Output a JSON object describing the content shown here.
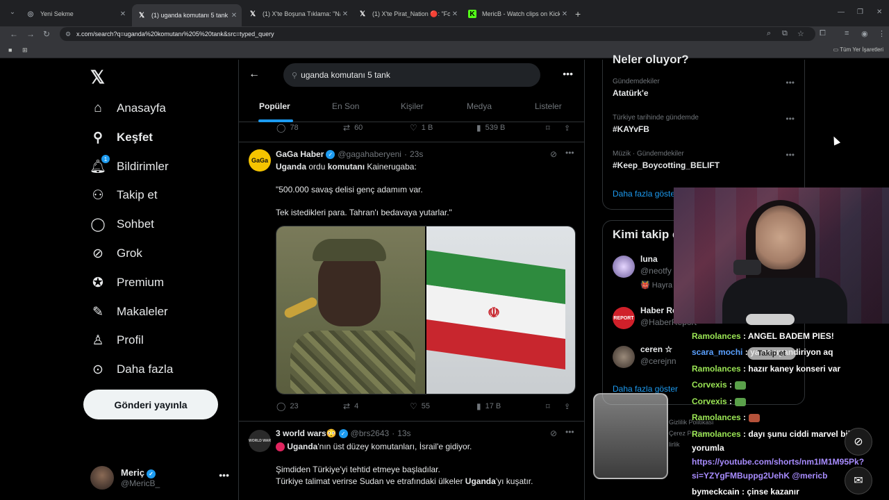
{
  "browser": {
    "tabs": [
      {
        "label": "Yeni Sekme",
        "icon": "chrome-icon"
      },
      {
        "label": "(1) uganda komutanı 5 tank - A",
        "icon": "x-icon"
      },
      {
        "label": "(1) X'te Boşuna Tıklama: \"Nakit",
        "icon": "x-icon"
      },
      {
        "label": "(1) X'te Pirat_Nation 🔴: \"Form",
        "icon": "x-icon"
      },
      {
        "label": "MericB - Watch clips on Kick",
        "icon": "kick-icon"
      }
    ],
    "url": "x.com/search?q=uganda%20komutanı%205%20tank&src=typed_query",
    "bookmarks_all": "Tüm Yer İşaretleri",
    "colors": {
      "tabbar": "#202124",
      "toolbar": "#35363a"
    }
  },
  "nav": {
    "items": [
      {
        "label": "Anasayfa",
        "icon": "home-icon"
      },
      {
        "label": "Keşfet",
        "icon": "search-icon"
      },
      {
        "label": "Bildirimler",
        "icon": "bell-icon",
        "badge": "1"
      },
      {
        "label": "Takip et",
        "icon": "person-add-icon"
      },
      {
        "label": "Sohbet",
        "icon": "chat-icon"
      },
      {
        "label": "Grok",
        "icon": "grok-icon"
      },
      {
        "label": "Premium",
        "icon": "premium-icon"
      },
      {
        "label": "Makaleler",
        "icon": "articles-icon"
      },
      {
        "label": "Profil",
        "icon": "profile-icon"
      },
      {
        "label": "Daha fazla",
        "icon": "more-circle-icon"
      }
    ],
    "post_button": "Gönderi yayınla",
    "account": {
      "name": "Meriç",
      "handle": "@MericB_"
    }
  },
  "search": {
    "query": "uganda komutanı 5 tank",
    "tabs": [
      "Popüler",
      "En Son",
      "Kişiler",
      "Medya",
      "Listeler"
    ],
    "active_tab": "Popüler"
  },
  "prev_actions": {
    "replies": "78",
    "reposts": "60",
    "likes": "1 B",
    "views": "539 B"
  },
  "tweets": [
    {
      "name": "GaGa Haber",
      "handle": "@gagahaberyeni",
      "time": "23s",
      "avatar_text": "GaGa",
      "line1_bold": "Uganda",
      "line1_a": " ordu ",
      "line1_bold2": "komutanı",
      "line1_b": " Kainerugaba:",
      "para2": "\"500.000 savaş delisi genç adamım var.",
      "para3": "Tek istedikleri para. Tahran'ı bedavaya yutarlar.\"",
      "actions": {
        "replies": "23",
        "reposts": "4",
        "likes": "55",
        "views": "17 B"
      }
    },
    {
      "name": "3 world wars😳",
      "handle": "@brs2643",
      "time": "13s",
      "avatar_text": "WORLD WAR",
      "line1_bold": "Uganda",
      "line1_b": "'nın üst düzey komutanları, İsrail'e gidiyor.",
      "para2": "Şimdiden Türkiye'yi tehtid etmeye başladılar.",
      "para3_a": "Türkiye talimat verirse Sudan ve etrafındaki ülkeler ",
      "para3_bold": "Uganda",
      "para3_b": "'yı kuşatır."
    }
  ],
  "trends": {
    "heading": "Neler oluyor?",
    "items": [
      {
        "context": "Gündemdekiler",
        "name": "Atatürk'e"
      },
      {
        "context": "Türkiye tarihinde gündemde",
        "name": "#KAYvFB"
      },
      {
        "context": "Müzik · Gündemdekiler",
        "name": "#Keep_Boycotting_BELIFT"
      }
    ],
    "more": "Daha fazla göster"
  },
  "who_to_follow": {
    "heading": "Kimi takip et",
    "items": [
      {
        "name": "luna",
        "handle": "@neotfy",
        "extra": "👹 Hayra"
      },
      {
        "name": "Haber Re",
        "handle": "@HaberReport"
      },
      {
        "name": "ceren ☆",
        "handle": "@cerejnn"
      }
    ],
    "more": "Daha fazla göster"
  },
  "footer": {
    "line1": "Gizlilik Politikası",
    "line2": "Çerez Politikası",
    "line3": "lirlik"
  },
  "overlay": {
    "follow_button": "Takip et",
    "chat": [
      {
        "user": "Ramolances",
        "msg": "ANGEL BADEM PIES!"
      },
      {
        "user": "scara_mochi",
        "msg": "ya ne uyandiriyon aq",
        "color": "blue"
      },
      {
        "user": "Ramolances",
        "msg": "hazır kaney konseri var"
      },
      {
        "user": "Corvexis",
        "msg": "",
        "emoji": "money"
      },
      {
        "user": "Corvexis",
        "msg": "",
        "emoji": "money"
      },
      {
        "user": "Ramolances",
        "msg": "",
        "emoji": "box"
      },
      {
        "user": "Ramolances",
        "msg": "dayı şunu ciddi marvel bilgiyle yorumla"
      },
      {
        "user": "",
        "link": "https://youtube.com/shorts/nm1IM1M95Pk?si=YZYgFMBuppg2UehK",
        "mention": "@mericb"
      },
      {
        "user": "bymeckcain",
        "msg": "çinse kazanır",
        "color": "white"
      }
    ]
  }
}
